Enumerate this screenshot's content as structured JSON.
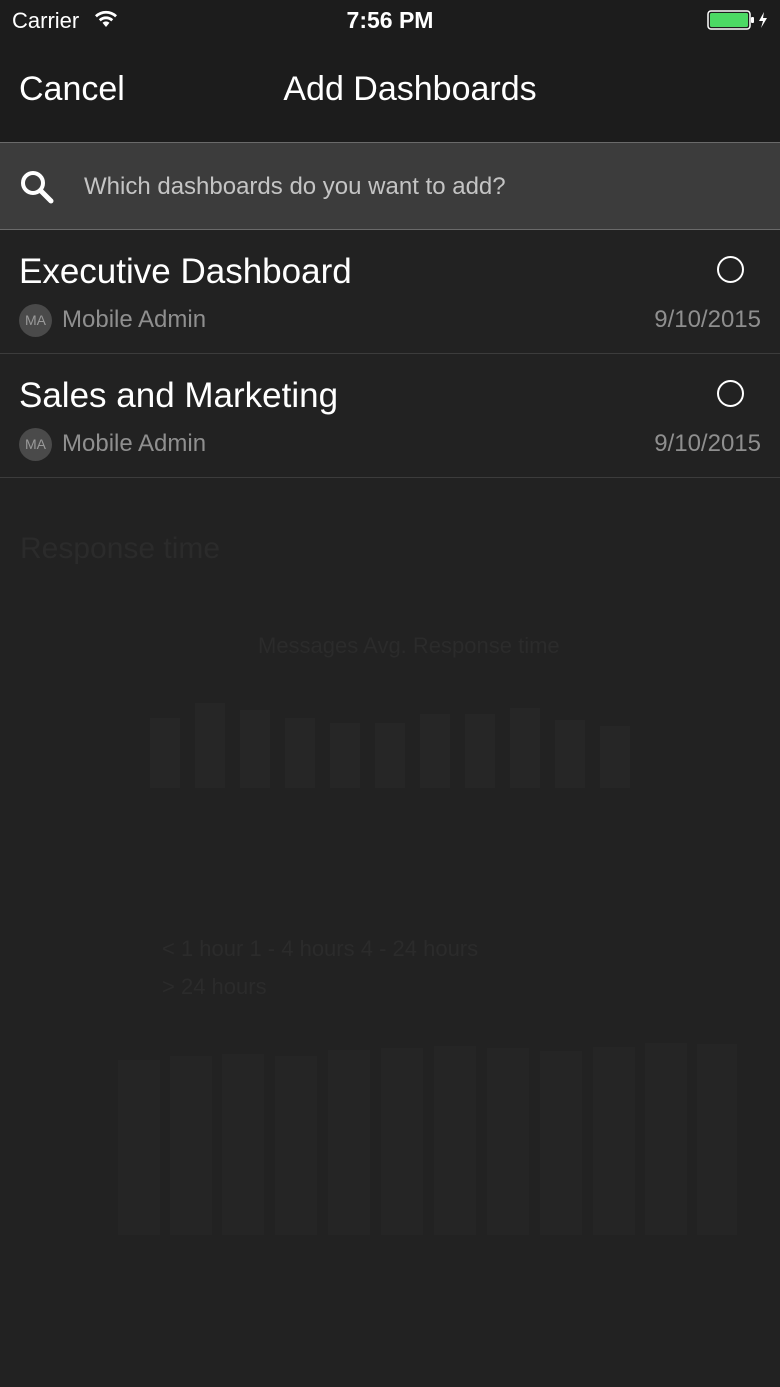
{
  "status_bar": {
    "carrier": "Carrier",
    "time": "7:56 PM",
    "battery_color": "#4cd964"
  },
  "nav": {
    "cancel_label": "Cancel",
    "title": "Add Dashboards"
  },
  "search": {
    "placeholder": "Which dashboards do you want to add?",
    "value": ""
  },
  "dashboards": [
    {
      "title": "Executive Dashboard",
      "avatar_initials": "MA",
      "owner": "Mobile Admin",
      "date": "9/10/2015",
      "selected": false
    },
    {
      "title": "Sales and Marketing",
      "avatar_initials": "MA",
      "owner": "Mobile Admin",
      "date": "9/10/2015",
      "selected": false
    }
  ],
  "background": {
    "section_title": "Response time",
    "legend_line1": "Messages    Avg. Response time",
    "legend_line2": "< 1 hour    1 - 4 hours    4 - 24 hours",
    "legend_line3": "> 24 hours"
  },
  "colors": {
    "background": "#222222",
    "bar": "#1c1c1c",
    "search_field": "#3c3c3c",
    "secondary_text": "#8f8f8f"
  },
  "icons": [
    "wifi-icon",
    "battery-icon",
    "search-icon",
    "radio-unselected-icon"
  ]
}
